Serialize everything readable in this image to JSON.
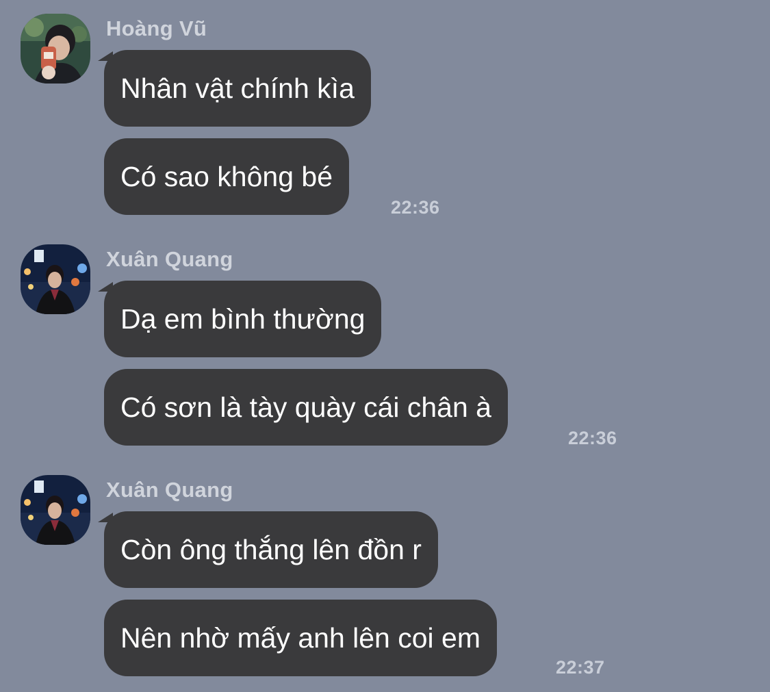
{
  "messages": [
    {
      "sender": "Hoàng Vũ",
      "avatar_icon": "avatar-hoang-vu",
      "bubbles": [
        "Nhân vật chính kìa",
        "Có sao không bé"
      ],
      "time": "22:36"
    },
    {
      "sender": "Xuân Quang",
      "avatar_icon": "avatar-xuan-quang",
      "bubbles": [
        "Dạ em bình thường",
        "Có sơn là tày quày cái chân à"
      ],
      "time": "22:36"
    },
    {
      "sender": "Xuân Quang",
      "avatar_icon": "avatar-xuan-quang",
      "bubbles": [
        "Còn ông thắng lên đồn r",
        "Nên nhờ mấy anh lên coi em"
      ],
      "time": "22:37"
    }
  ],
  "colors": {
    "background": "#828a9c",
    "bubble": "#3a3a3c",
    "bubble_text": "#ffffff",
    "meta_text": "#d0d4dc"
  }
}
